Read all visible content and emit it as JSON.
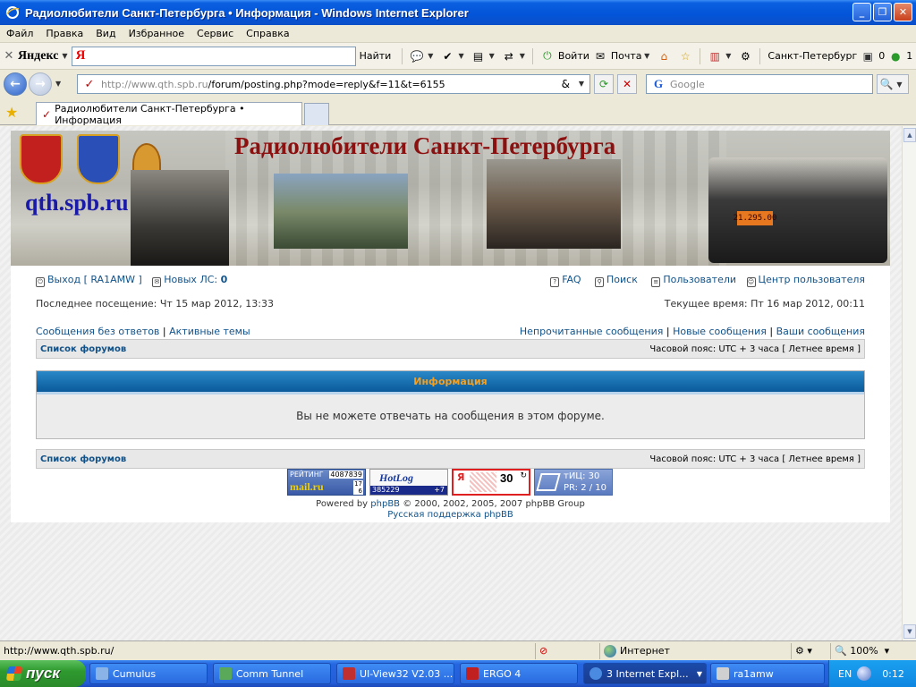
{
  "window": {
    "title": "Радиолюбители Санкт-Петербурга • Информация - Windows Internet Explorer",
    "controls": {
      "minimize": "_",
      "maximize": "❐",
      "close": "✕"
    }
  },
  "menu": [
    "Файл",
    "Правка",
    "Вид",
    "Избранное",
    "Сервис",
    "Справка"
  ],
  "yandex_bar": {
    "logo": "Яндекс",
    "input_logo": "Я",
    "find_label": "Найти",
    "login_label": "Войти",
    "mail_label": "Почта",
    "city": "Санкт-Петербург",
    "counter1": "0",
    "counter2": "1"
  },
  "address_bar": {
    "url_host": "http://www.qth.spb.ru",
    "url_path": "/forum/posting.php?mode=reply&f=11&t=6155",
    "search_placeholder": "Google"
  },
  "tab": {
    "title": "Радиолюбители Санкт-Петербурга • Информация"
  },
  "banner": {
    "title": "Радиолюбители Санкт-Петербурга",
    "site": "qth.spb.ru",
    "radio_display": "21.295.00"
  },
  "forum": {
    "logout_label": "Выход [ RA1AMW ]",
    "pm_label": "Новых ЛС:",
    "pm_count": "0",
    "faq": "FAQ",
    "search": "Поиск",
    "members": "Пользователи",
    "ucp": "Центр пользователя",
    "last_visit": "Последнее посещение: Чт 15 мар 2012, 13:33",
    "current_time": "Текущее время: Пт 16 мар 2012, 00:11",
    "unanswered": "Сообщения без ответов",
    "active_topics": "Активные темы",
    "unread": "Непрочитанные сообщения",
    "new_posts": "Новые сообщения",
    "your_posts": "Ваши сообщения",
    "breadcrumb": "Список форумов",
    "timezone": "Часовой пояс: UTC + 3 часа [ Летнее время ]",
    "info_title": "Информация",
    "info_message": "Вы не можете отвечать на сообщения в этом форуме.",
    "pipe": "|"
  },
  "counters": {
    "mail": {
      "label": "РЕЙТИНГ",
      "value": "4087839",
      "brand": "mail.ru",
      "n1": "17",
      "n2": "6"
    },
    "hotlog": {
      "brand": "HotLog",
      "value": "385229",
      "delta": "+7"
    },
    "yandex": {
      "logo": "Я",
      "value": "30",
      "arrow": "↻"
    },
    "tic": {
      "line1": "тИЦ: 30",
      "line2": "PR: 2 / 10"
    }
  },
  "footer": {
    "powered_prefix": "Powered by ",
    "powered_link": "phpBB",
    "powered_suffix": " © 2000, 2002, 2005, 2007 phpBB Group",
    "support": "Русская поддержка phpBB"
  },
  "status_bar": {
    "url": "http://www.qth.spb.ru/",
    "zone": "Интернет",
    "zoom": "100%"
  },
  "taskbar": {
    "start": "пуск",
    "tasks": [
      {
        "label": "Cumulus",
        "color": "#8ab4e8"
      },
      {
        "label": "Comm Tunnel",
        "color": "#5aa85a"
      },
      {
        "label": "UI-View32 V2.03 ...",
        "color": "#c03030"
      },
      {
        "label": "ERGO 4",
        "color": "#c02020"
      },
      {
        "label": "3 Internet Expl...",
        "color": "#4a8ae0"
      },
      {
        "label": "ra1amw",
        "color": "#d0d0d0"
      }
    ],
    "lang": "EN",
    "clock": "0:12"
  },
  "colors": {
    "link": "#105289",
    "info_header": "#0a5a9a",
    "info_title": "#f5a020",
    "banner_title": "#8b1010",
    "banner_site": "#1a1aa8"
  }
}
